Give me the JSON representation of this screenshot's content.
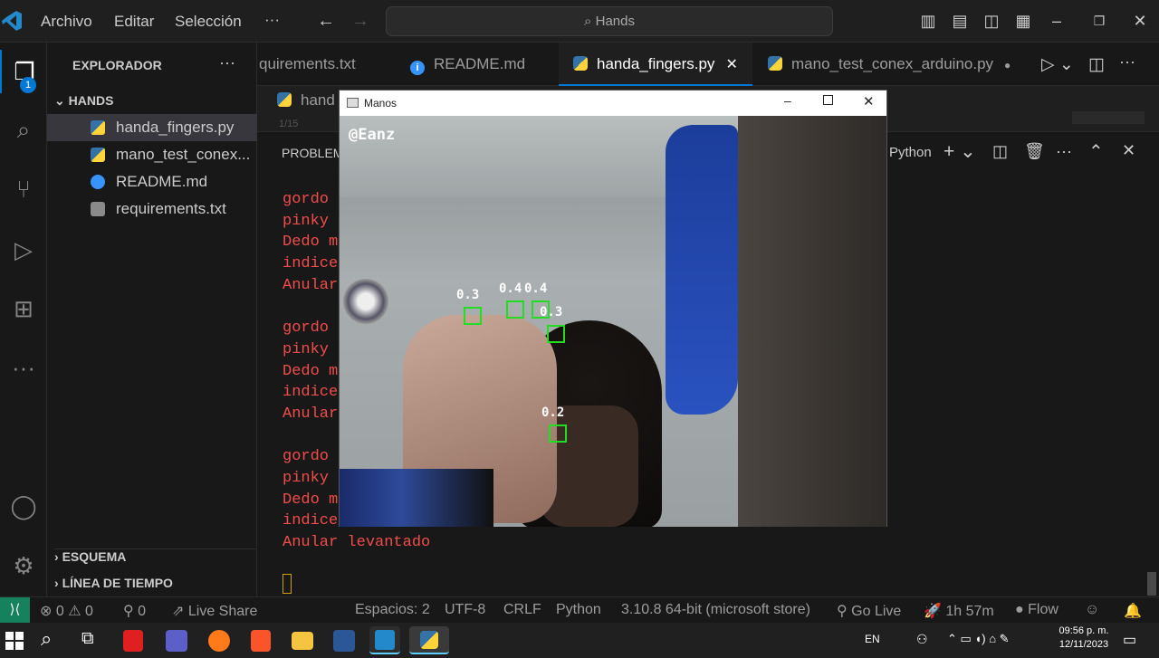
{
  "menu": {
    "file": "Archivo",
    "edit": "Editar",
    "selection": "Selección",
    "more": "···"
  },
  "search": {
    "text": "Hands"
  },
  "sidebar": {
    "title": "EXPLORADOR",
    "more": "···",
    "folder": "HANDS",
    "files": [
      {
        "name": "handa_fingers.py",
        "icon": "python-icon"
      },
      {
        "name": "mano_test_conex...",
        "icon": "python-icon"
      },
      {
        "name": "README.md",
        "icon": "info-icon"
      },
      {
        "name": "requirements.txt",
        "icon": "text-file-icon"
      }
    ],
    "outline": "ESQUEMA",
    "timeline": "LÍNEA DE TIEMPO",
    "badge": "1"
  },
  "tabs": [
    {
      "label": "quirements.txt"
    },
    {
      "label": "README.md"
    },
    {
      "label": "handa_fingers.py"
    },
    {
      "label": "mano_test_conex_arduino.py"
    }
  ],
  "breadcrumb": {
    "file": "hand",
    "lineinfo": "1/15"
  },
  "panel": {
    "tab": "PROBLEM",
    "shell": "Python",
    "lines": [
      "gordo",
      "pinky",
      "Dedo m",
      "indice",
      "Anular",
      "",
      "gordo",
      "pinky",
      "Dedo m",
      "indice",
      "Anular",
      "",
      "gordo",
      "pinky",
      "Dedo m",
      "indice",
      "Anular levantado"
    ]
  },
  "window": {
    "title": "Manos",
    "watermark": "@Eanz",
    "labels": [
      "0.3",
      "0.4",
      "0.4",
      "0.3",
      "0.2"
    ]
  },
  "status": {
    "errors": "0",
    "warnings": "0",
    "ports": "0",
    "liveshare": "Live Share",
    "spaces": "Espacios: 2",
    "encoding": "UTF-8",
    "eol": "CRLF",
    "language": "Python",
    "interpreter": "3.10.8 64-bit (microsoft store)",
    "golive": "Go Live",
    "timer": "1h 57m",
    "flow": "Flow"
  },
  "taskbar": {
    "lang": "EN",
    "time": "09:56 p. m.",
    "date": "12/11/2023"
  },
  "colors": {
    "accent": "#0078d4",
    "terminalText": "#f14c4c",
    "remote": "#16825d"
  }
}
